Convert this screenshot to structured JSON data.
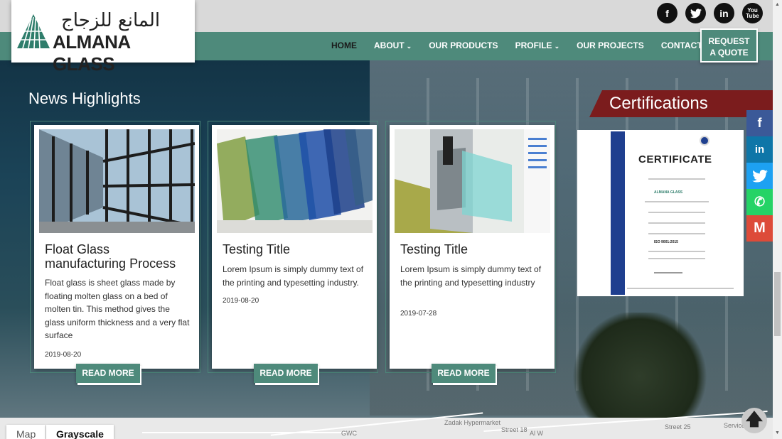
{
  "brand": {
    "arabic_name": "المانع للزجاج",
    "name": "ALMANA GLASS"
  },
  "social_top": [
    {
      "icon": "facebook-icon",
      "glyph": "f"
    },
    {
      "icon": "twitter-icon",
      "glyph": "t"
    },
    {
      "icon": "linkedin-icon",
      "glyph": "in"
    },
    {
      "icon": "youtube-icon",
      "glyph": "You Tube"
    }
  ],
  "nav": {
    "home": "HOME",
    "about": "ABOUT",
    "products": "OUR PRODUCTS",
    "profile": "PROFILE",
    "projects": "OUR PROJECTS",
    "contact": "CONTACT US",
    "quote_line1": "REQUEST",
    "quote_line2": "A QUOTE"
  },
  "news": {
    "title": "News Highlights",
    "cards": [
      {
        "title": "Float Glass manufacturing Process",
        "desc": "Float glass is sheet glass made by floating molten glass on a bed of molten tin. This method gives the glass uniform thickness and a very flat surface",
        "date": "2019-08-20",
        "button": "READ MORE"
      },
      {
        "title": "Testing Title",
        "desc": "Lorem Ipsum is simply dummy text of the printing and typesetting industry.",
        "date": "2019-08-20",
        "button": "READ MORE"
      },
      {
        "title": "Testing Title",
        "desc": "Lorem Ipsum  is simply dummy text of the printing and typesetting industry",
        "date": "2019-07-28",
        "button": "READ MORE"
      }
    ]
  },
  "certifications": {
    "title": "Certifications",
    "doc_title": "CERTIFICATE",
    "company": "ALMANA GLASS",
    "standard": "ISO 9001:2015"
  },
  "share_side": [
    {
      "icon": "facebook-share-icon",
      "glyph": "f",
      "color": "#3b5998"
    },
    {
      "icon": "linkedin-share-icon",
      "glyph": "in",
      "color": "#0e76a8"
    },
    {
      "icon": "twitter-share-icon",
      "glyph": "t",
      "color": "#1da1f2"
    },
    {
      "icon": "whatsapp-share-icon",
      "glyph": "✆",
      "color": "#25d366"
    },
    {
      "icon": "gmail-share-icon",
      "glyph": "M",
      "color": "#dd4b39"
    }
  ],
  "map": {
    "tab_map": "Map",
    "tab_gray": "Grayscale",
    "labels": [
      "GWC",
      "Zadak Hypermarket",
      "Street 18",
      "Street 25",
      "Service Cen",
      "Al W"
    ]
  },
  "colors": {
    "accent_green": "#4e8a7b",
    "cert_red": "#7b1c1d"
  }
}
